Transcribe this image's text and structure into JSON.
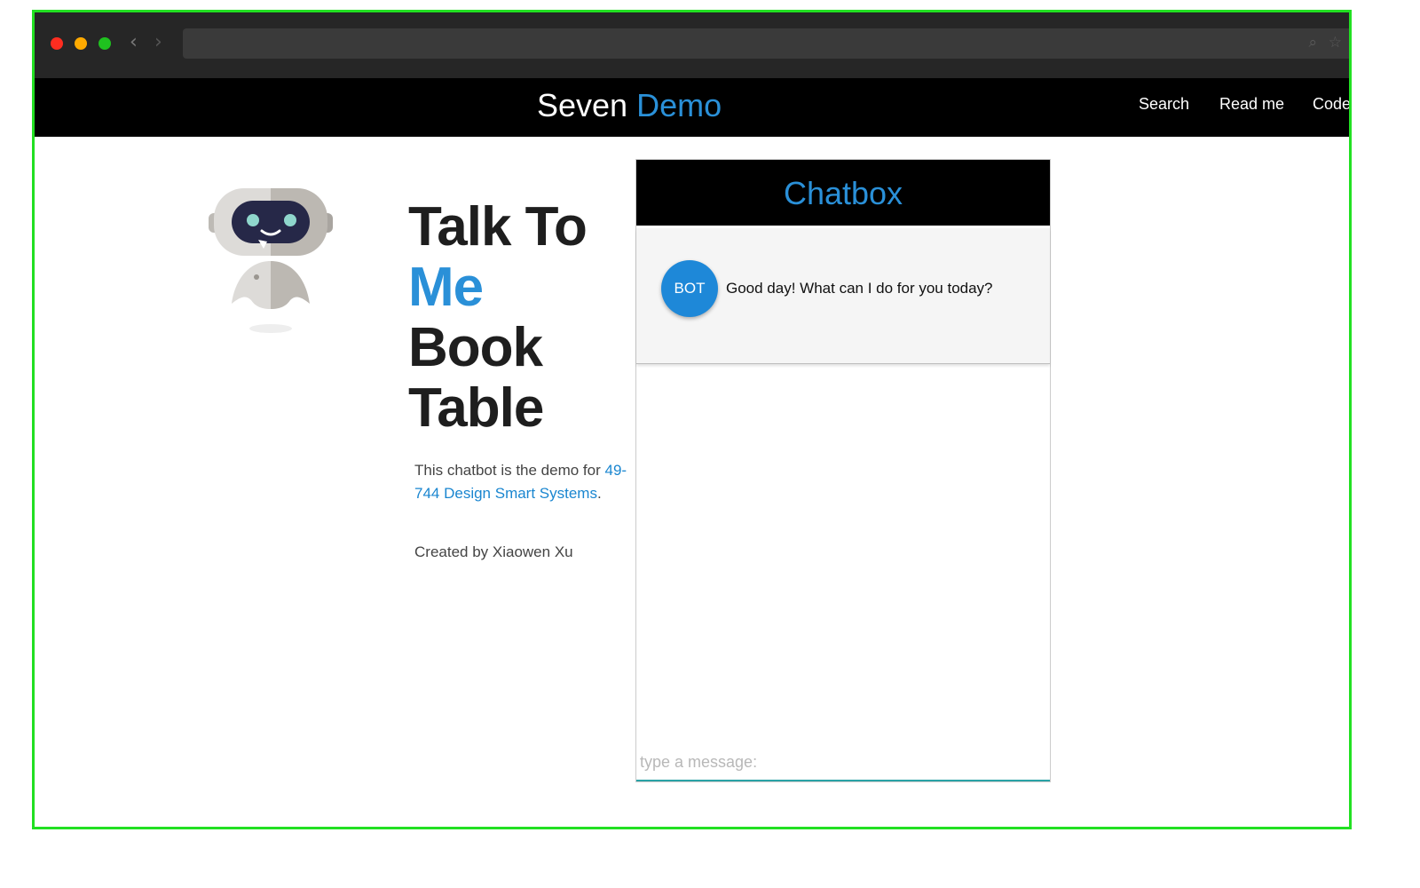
{
  "browser": {
    "close_color": "#ff2d20",
    "minimize_color": "#ffaa00",
    "maximize_color": "#1fc11f",
    "back_icon": "chevron-left-icon",
    "forward_icon": "chevron-right-icon",
    "search_icon": "search-icon",
    "bookmark_icon": "star-icon"
  },
  "nav": {
    "brand_primary": "Seven",
    "brand_accent": "Demo",
    "links": [
      "Search",
      "Read me",
      "Code"
    ],
    "accent_color": "#2a90d8"
  },
  "hero": {
    "line1": "Talk To",
    "line2": "Me",
    "line3": "Book",
    "line4": "Table",
    "desc_prefix": "This chatbot is the demo for",
    "desc_link": "49-744 Design Smart Systems",
    "desc_suffix": ".",
    "credit": "Created by Xiaowen Xu"
  },
  "chat": {
    "title": "Chatbox",
    "messages": [
      {
        "sender": "BOT",
        "text": "Good day! What can I do for you today?"
      }
    ],
    "input_value": "",
    "input_placeholder": "type a message:"
  }
}
